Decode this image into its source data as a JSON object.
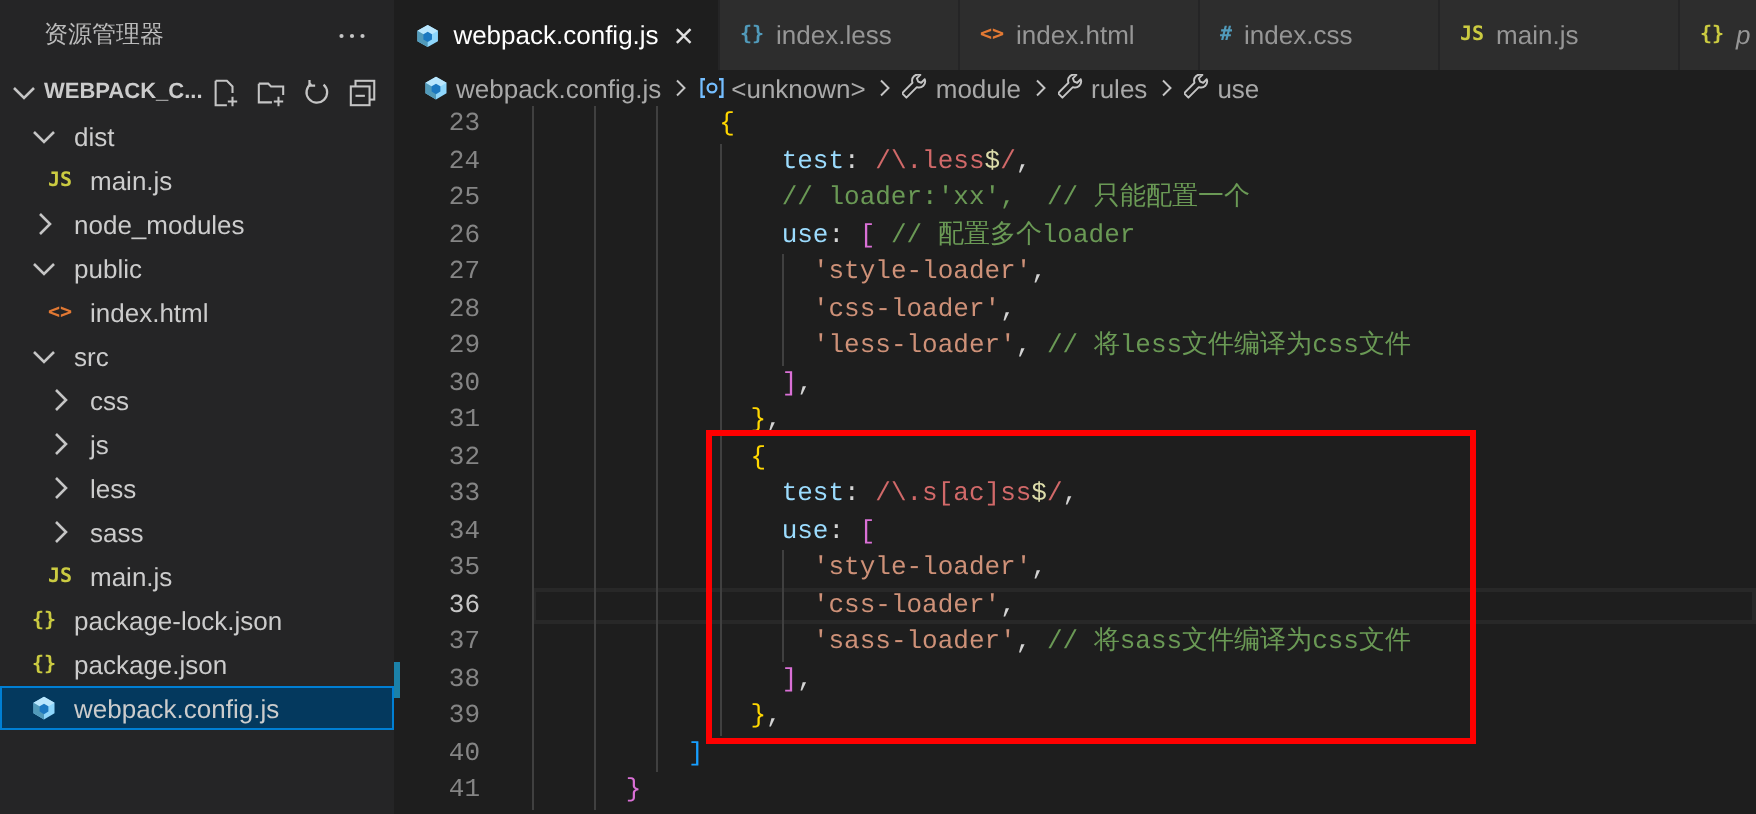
{
  "sidebar": {
    "title": "资源管理器",
    "root": {
      "label": "WEBPACK_C...",
      "expanded": true
    },
    "items": [
      {
        "label": "dist",
        "kind": "folder",
        "expanded": true,
        "selected": false,
        "children": [
          {
            "label": "main.js",
            "kind": "js",
            "icon": "JS",
            "selected": false
          }
        ]
      },
      {
        "label": "node_modules",
        "kind": "folder",
        "expanded": false,
        "selected": false
      },
      {
        "label": "public",
        "kind": "folder",
        "expanded": true,
        "selected": false,
        "children": [
          {
            "label": "index.html",
            "kind": "html",
            "icon": "<>",
            "selected": false
          }
        ]
      },
      {
        "label": "src",
        "kind": "folder",
        "expanded": true,
        "selected": false,
        "children": [
          {
            "label": "css",
            "kind": "folder",
            "expanded": false,
            "selected": false
          },
          {
            "label": "js",
            "kind": "folder",
            "expanded": false,
            "selected": false
          },
          {
            "label": "less",
            "kind": "folder",
            "expanded": false,
            "selected": false
          },
          {
            "label": "sass",
            "kind": "folder",
            "expanded": false,
            "selected": false
          },
          {
            "label": "main.js",
            "kind": "js",
            "icon": "JS",
            "selected": false
          }
        ]
      },
      {
        "label": "package-lock.json",
        "kind": "json",
        "icon": "{}",
        "selected": false
      },
      {
        "label": "package.json",
        "kind": "json",
        "icon": "{}",
        "selected": false
      },
      {
        "label": "webpack.config.js",
        "kind": "webpack",
        "selected": true
      }
    ]
  },
  "tabs": [
    {
      "label": "webpack.config.js",
      "kind": "webpack",
      "selected": true,
      "preview": false
    },
    {
      "label": "index.less",
      "kind": "less",
      "icon": "{}",
      "selected": false,
      "preview": false
    },
    {
      "label": "index.html",
      "kind": "html",
      "icon": "<>",
      "selected": false,
      "preview": false
    },
    {
      "label": "index.css",
      "kind": "css",
      "icon": "#",
      "selected": false,
      "preview": false
    },
    {
      "label": "main.js",
      "kind": "js",
      "icon": "JS",
      "selected": false,
      "preview": false
    },
    {
      "label": "p",
      "kind": "json",
      "icon": "{}",
      "selected": false,
      "preview": true
    }
  ],
  "breadcrumb": [
    {
      "label": "webpack.config.js",
      "kind": "webpack"
    },
    {
      "label": "<unknown>",
      "kind": "namespace"
    },
    {
      "label": "module",
      "kind": "wrench"
    },
    {
      "label": "rules",
      "kind": "wrench"
    },
    {
      "label": "use",
      "kind": "wrench"
    }
  ],
  "code": [
    {
      "kind": "plain",
      "lines": [
        {
          "number": "23",
          "current": false,
          "modified": false,
          "tokens": [
            {
              "kind": "b1",
              "text": "            {"
            }
          ]
        },
        {
          "number": "24",
          "current": false,
          "modified": false,
          "tokens": [
            {
              "kind": "prop",
              "text": "                test"
            },
            {
              "kind": "punct",
              "text": ": "
            },
            {
              "kind": "regex",
              "text": "/\\.less"
            },
            {
              "kind": "anchor",
              "text": "$"
            },
            {
              "kind": "regex",
              "text": "/"
            },
            {
              "kind": "punct",
              "text": ","
            }
          ]
        },
        {
          "number": "25",
          "current": false,
          "modified": false,
          "tokens": [
            {
              "kind": "comment",
              "text": "                // loader:'xx',  // 只能配置一个"
            }
          ]
        },
        {
          "number": "26",
          "current": false,
          "modified": false,
          "tokens": [
            {
              "kind": "prop",
              "text": "                use"
            },
            {
              "kind": "punct",
              "text": ": "
            },
            {
              "kind": "b2",
              "text": "["
            },
            {
              "kind": "comment",
              "text": " // 配置多个loader"
            }
          ]
        },
        {
          "number": "27",
          "current": false,
          "modified": false,
          "tokens": [
            {
              "kind": "string",
              "text": "                  'style-loader'"
            },
            {
              "kind": "punct",
              "text": ","
            }
          ]
        },
        {
          "number": "28",
          "current": false,
          "modified": false,
          "tokens": [
            {
              "kind": "string",
              "text": "                  'css-loader'"
            },
            {
              "kind": "punct",
              "text": ","
            }
          ]
        },
        {
          "number": "29",
          "current": false,
          "modified": false,
          "tokens": [
            {
              "kind": "string",
              "text": "                  'less-loader'"
            },
            {
              "kind": "punct",
              "text": ", "
            },
            {
              "kind": "comment",
              "text": "// 将less文件编译为css文件"
            }
          ]
        },
        {
          "number": "30",
          "current": false,
          "modified": false,
          "tokens": [
            {
              "kind": "b2",
              "text": "                ]"
            },
            {
              "kind": "punct",
              "text": ","
            }
          ]
        },
        {
          "number": "31",
          "current": false,
          "modified": false,
          "tokens": [
            {
              "kind": "b1",
              "text": "              }"
            },
            {
              "kind": "punct",
              "text": ","
            }
          ]
        }
      ]
    },
    {
      "kind": "boxed",
      "lines": [
        {
          "number": "32",
          "current": false,
          "modified": false,
          "tokens": [
            {
              "kind": "b1",
              "text": "              {"
            }
          ]
        },
        {
          "number": "33",
          "current": false,
          "modified": false,
          "tokens": [
            {
              "kind": "prop",
              "text": "                test"
            },
            {
              "kind": "punct",
              "text": ": "
            },
            {
              "kind": "regex",
              "text": "/\\.s[ac]ss"
            },
            {
              "kind": "anchor",
              "text": "$"
            },
            {
              "kind": "regex",
              "text": "/"
            },
            {
              "kind": "punct",
              "text": ","
            }
          ]
        },
        {
          "number": "34",
          "current": false,
          "modified": false,
          "tokens": [
            {
              "kind": "prop",
              "text": "                use"
            },
            {
              "kind": "punct",
              "text": ": "
            },
            {
              "kind": "b2",
              "text": "["
            }
          ]
        },
        {
          "number": "35",
          "current": false,
          "modified": false,
          "tokens": [
            {
              "kind": "string",
              "text": "                  'style-loader'"
            },
            {
              "kind": "punct",
              "text": ","
            }
          ]
        },
        {
          "number": "36",
          "current": true,
          "modified": false,
          "tokens": [
            {
              "kind": "string",
              "text": "                  'css-loader'"
            },
            {
              "kind": "punct",
              "text": ","
            }
          ]
        },
        {
          "number": "37",
          "current": false,
          "modified": false,
          "tokens": [
            {
              "kind": "string",
              "text": "                  'sass-loader'"
            },
            {
              "kind": "punct",
              "text": ", "
            },
            {
              "kind": "comment",
              "text": "// 将sass文件编译为css文件"
            }
          ]
        },
        {
          "number": "38",
          "current": false,
          "modified": true,
          "tokens": [
            {
              "kind": "b2",
              "text": "                ]"
            },
            {
              "kind": "punct",
              "text": ","
            }
          ]
        },
        {
          "number": "39",
          "current": false,
          "modified": false,
          "tokens": [
            {
              "kind": "b1",
              "text": "              }"
            },
            {
              "kind": "punct",
              "text": ","
            }
          ]
        }
      ]
    },
    {
      "kind": "plain",
      "lines": [
        {
          "number": "40",
          "current": false,
          "modified": false,
          "tokens": [
            {
              "kind": "b3",
              "text": "          ]"
            }
          ]
        },
        {
          "number": "41",
          "current": false,
          "modified": false,
          "tokens": [
            {
              "kind": "b2",
              "text": "      }"
            }
          ]
        }
      ]
    }
  ]
}
